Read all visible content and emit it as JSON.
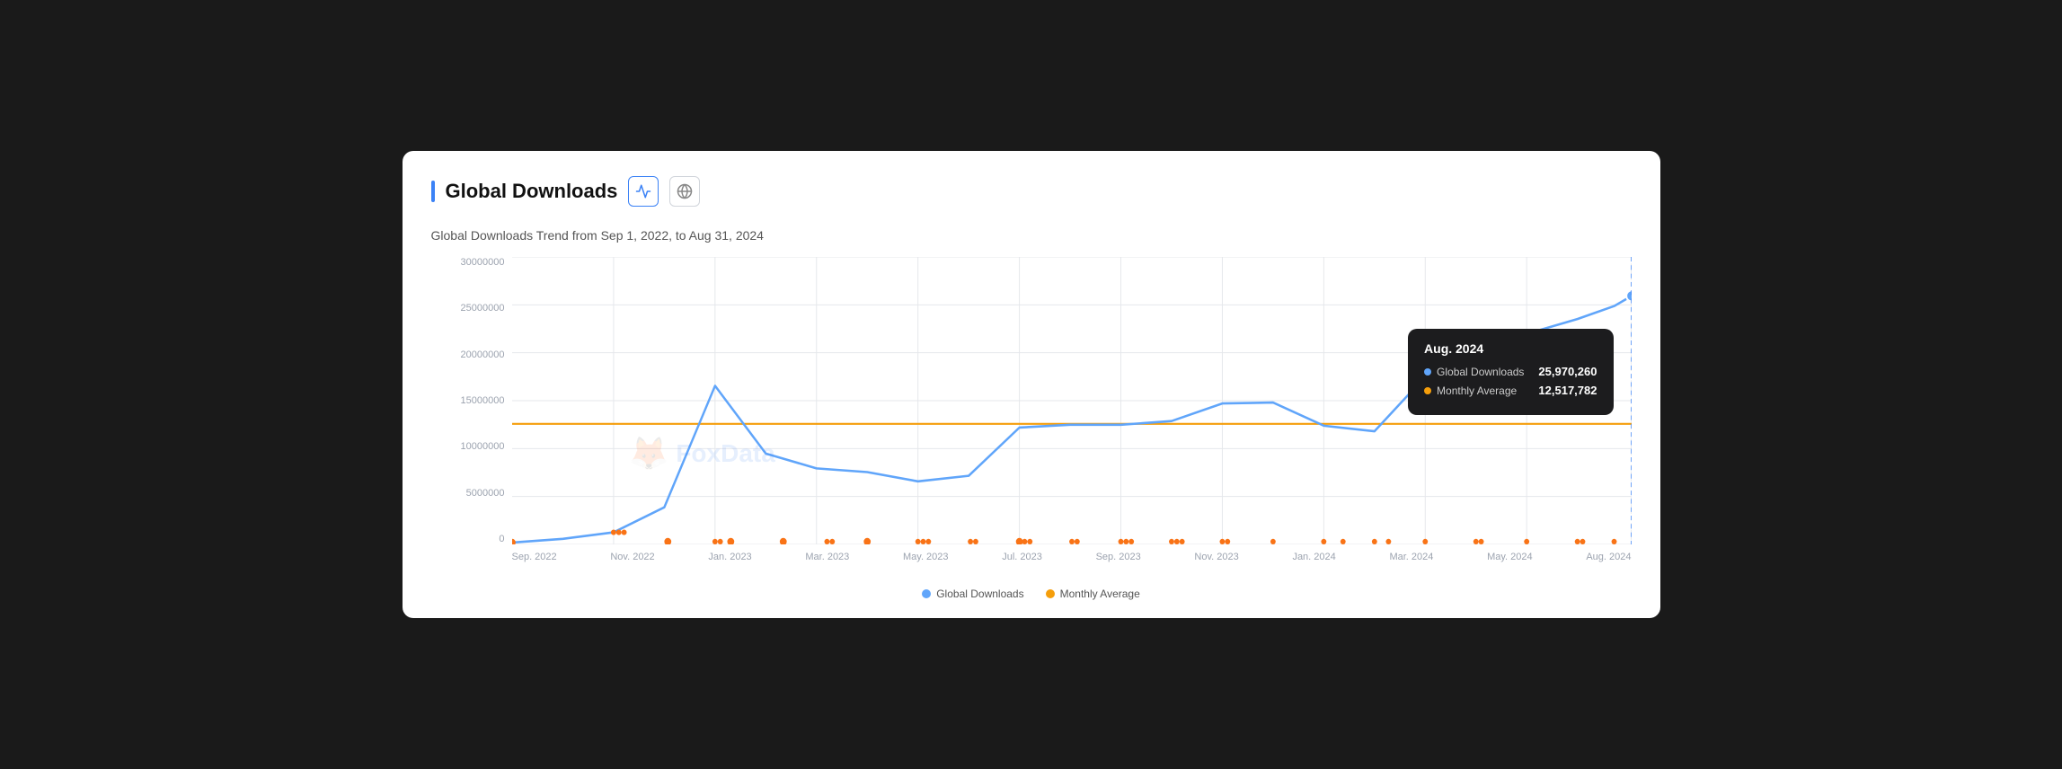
{
  "header": {
    "title": "Global Downloads",
    "chart_icon_label": "chart-icon",
    "globe_icon_label": "globe-icon"
  },
  "subtitle": "Global Downloads Trend from Sep 1, 2022, to Aug 31, 2024",
  "y_axis": {
    "labels": [
      "30000000",
      "25000000",
      "20000000",
      "15000000",
      "10000000",
      "5000000",
      "0"
    ]
  },
  "x_axis": {
    "labels": [
      "Sep. 2022",
      "Nov. 2022",
      "Jan. 2023",
      "Mar. 2023",
      "May. 2023",
      "Jul. 2023",
      "Sep. 2023",
      "Nov. 2023",
      "Jan. 2024",
      "Mar. 2024",
      "May. 2024",
      "Aug. 2024"
    ]
  },
  "legend": {
    "items": [
      {
        "label": "Global Downloads",
        "color": "#60a5fa"
      },
      {
        "label": "Monthly Average",
        "color": "#f59e0b"
      }
    ]
  },
  "tooltip": {
    "title": "Aug. 2024",
    "rows": [
      {
        "label": "Global Downloads",
        "value": "25,970,260",
        "color": "#60a5fa"
      },
      {
        "label": "Monthly Average",
        "value": "12,517,782",
        "color": "#f59e0b"
      }
    ]
  },
  "watermark": "FoxData",
  "colors": {
    "blue": "#60a5fa",
    "orange": "#f59e0b",
    "accent": "#3b82f6"
  }
}
